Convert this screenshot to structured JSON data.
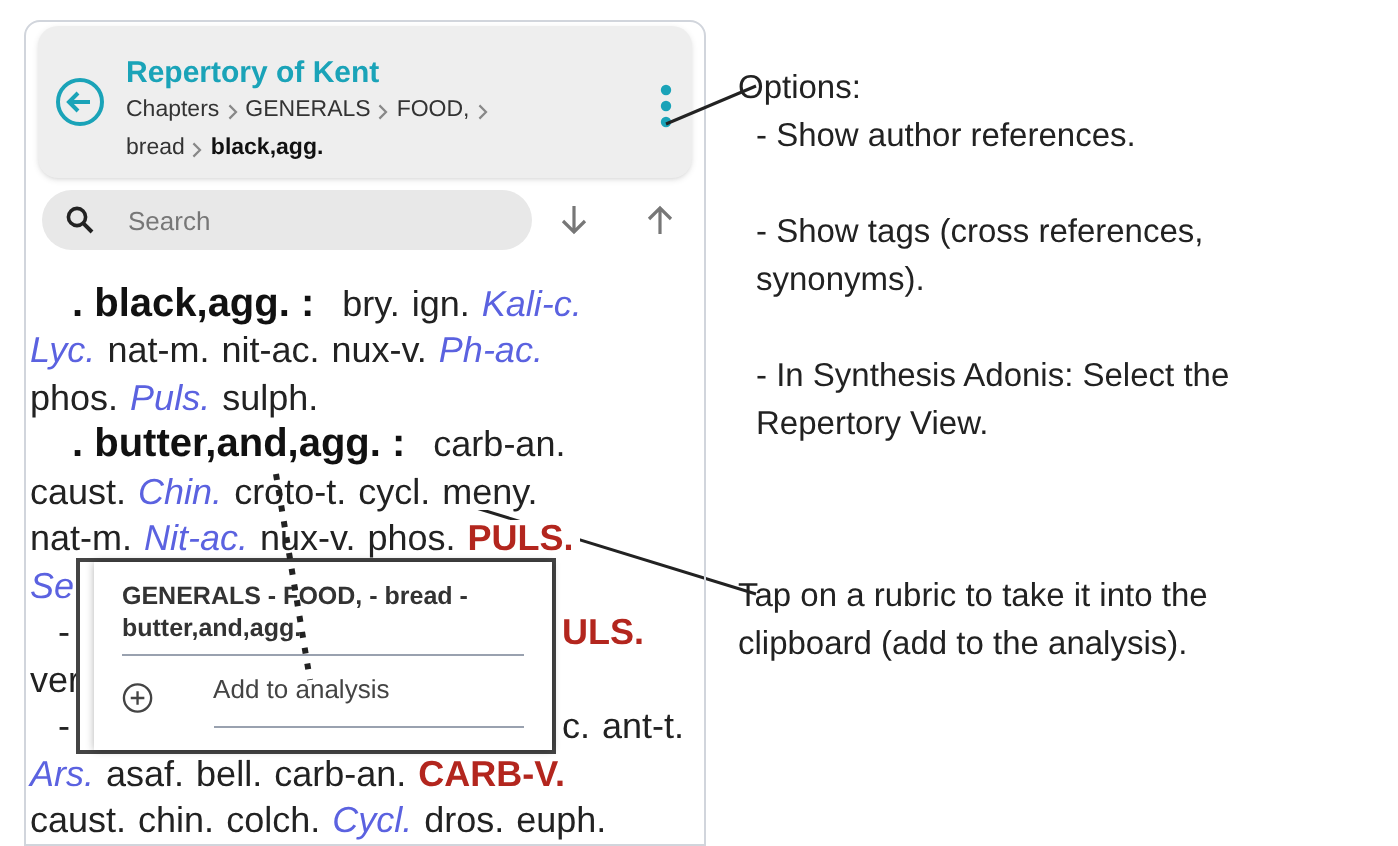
{
  "header": {
    "title": "Repertory of Kent",
    "breadcrumb": [
      {
        "label": "Chapters",
        "current": false
      },
      {
        "label": "GENERALS",
        "current": false
      },
      {
        "label": "FOOD,",
        "current": false
      },
      {
        "label": "bread",
        "current": false
      },
      {
        "label": "black,agg.",
        "current": true
      }
    ]
  },
  "search": {
    "placeholder": "Search"
  },
  "lines": [
    {
      "kind": "rubric",
      "left": [
        {
          "text": ". black,agg. :",
          "kind": "rubric"
        },
        {
          "text": "bry.",
          "kind": "plain"
        },
        {
          "text": "ign.",
          "kind": "plain"
        },
        {
          "text": "Kali-c.",
          "kind": "italic"
        }
      ]
    },
    {
      "kind": "plain",
      "left": [
        {
          "text": "Lyc.",
          "kind": "italic"
        },
        {
          "text": "nat-m.",
          "kind": "plain"
        },
        {
          "text": "nit-ac.",
          "kind": "plain"
        },
        {
          "text": "nux-v.",
          "kind": "plain"
        },
        {
          "text": "Ph-ac.",
          "kind": "italic"
        }
      ]
    },
    {
      "kind": "plain",
      "left": [
        {
          "text": "phos.",
          "kind": "plain"
        },
        {
          "text": "Puls.",
          "kind": "italic"
        },
        {
          "text": "sulph.",
          "kind": "plain"
        }
      ]
    },
    {
      "kind": "rubric",
      "left": [
        {
          "text": ". butter,and,agg. :",
          "kind": "rubric"
        },
        {
          "text": "carb-an.",
          "kind": "plain"
        }
      ]
    },
    {
      "kind": "plain",
      "left": [
        {
          "text": "caust.",
          "kind": "plain"
        },
        {
          "text": "Chin.",
          "kind": "italic"
        },
        {
          "text": "croto-t.",
          "kind": "plain"
        },
        {
          "text": "cycl.",
          "kind": "plain"
        },
        {
          "text": "meny.",
          "kind": "plain"
        }
      ]
    },
    {
      "kind": "plain",
      "left": [
        {
          "text": "nat-m.",
          "kind": "plain"
        },
        {
          "text": "Nit-ac.",
          "kind": "italic"
        },
        {
          "text": "nux-v.",
          "kind": "plain"
        },
        {
          "text": "phos.",
          "kind": "plain"
        },
        {
          "text": "PULS.",
          "kind": "strong"
        }
      ]
    },
    {
      "kind": "plain",
      "left": [
        {
          "text": "Se",
          "kind": "italic"
        }
      ]
    },
    {
      "kind": "split",
      "left": [
        {
          "text": "-",
          "kind": "plain"
        }
      ],
      "right": [
        {
          "text": "ULS.",
          "kind": "strong"
        }
      ]
    },
    {
      "kind": "plain",
      "left": [
        {
          "text": "ver",
          "kind": "plain"
        }
      ]
    },
    {
      "kind": "split",
      "left": [
        {
          "text": "-",
          "kind": "plain"
        }
      ],
      "right": [
        {
          "text": "c.",
          "kind": "plain"
        },
        {
          "text": "ant-t.",
          "kind": "plain"
        }
      ]
    },
    {
      "kind": "plain",
      "left": [
        {
          "text": "Ars.",
          "kind": "italic"
        },
        {
          "text": "asaf.",
          "kind": "plain"
        },
        {
          "text": "bell.",
          "kind": "plain"
        },
        {
          "text": "carb-an.",
          "kind": "plain"
        },
        {
          "text": "CARB-V.",
          "kind": "strong"
        }
      ]
    },
    {
      "kind": "plain",
      "left": [
        {
          "text": "caust.",
          "kind": "plain"
        },
        {
          "text": "chin.",
          "kind": "plain"
        },
        {
          "text": "colch.",
          "kind": "plain"
        },
        {
          "text": "Cycl.",
          "kind": "italic"
        },
        {
          "text": "dros.",
          "kind": "plain"
        },
        {
          "text": "euph.",
          "kind": "plain"
        }
      ]
    }
  ],
  "popup": {
    "title": "GENERALS - FOOD, - bread - butter,and,agg.",
    "action": "Add to analysis"
  },
  "annotations": [
    {
      "heading": "Options:",
      "items": [
        "- Show author references.",
        "- Show tags (cross references, synonyms).",
        "- In Synthesis Adonis: Select the Repertory View."
      ]
    },
    {
      "text": "Tap on a rubric to take it into the clipboard (add to the analysis)."
    }
  ]
}
